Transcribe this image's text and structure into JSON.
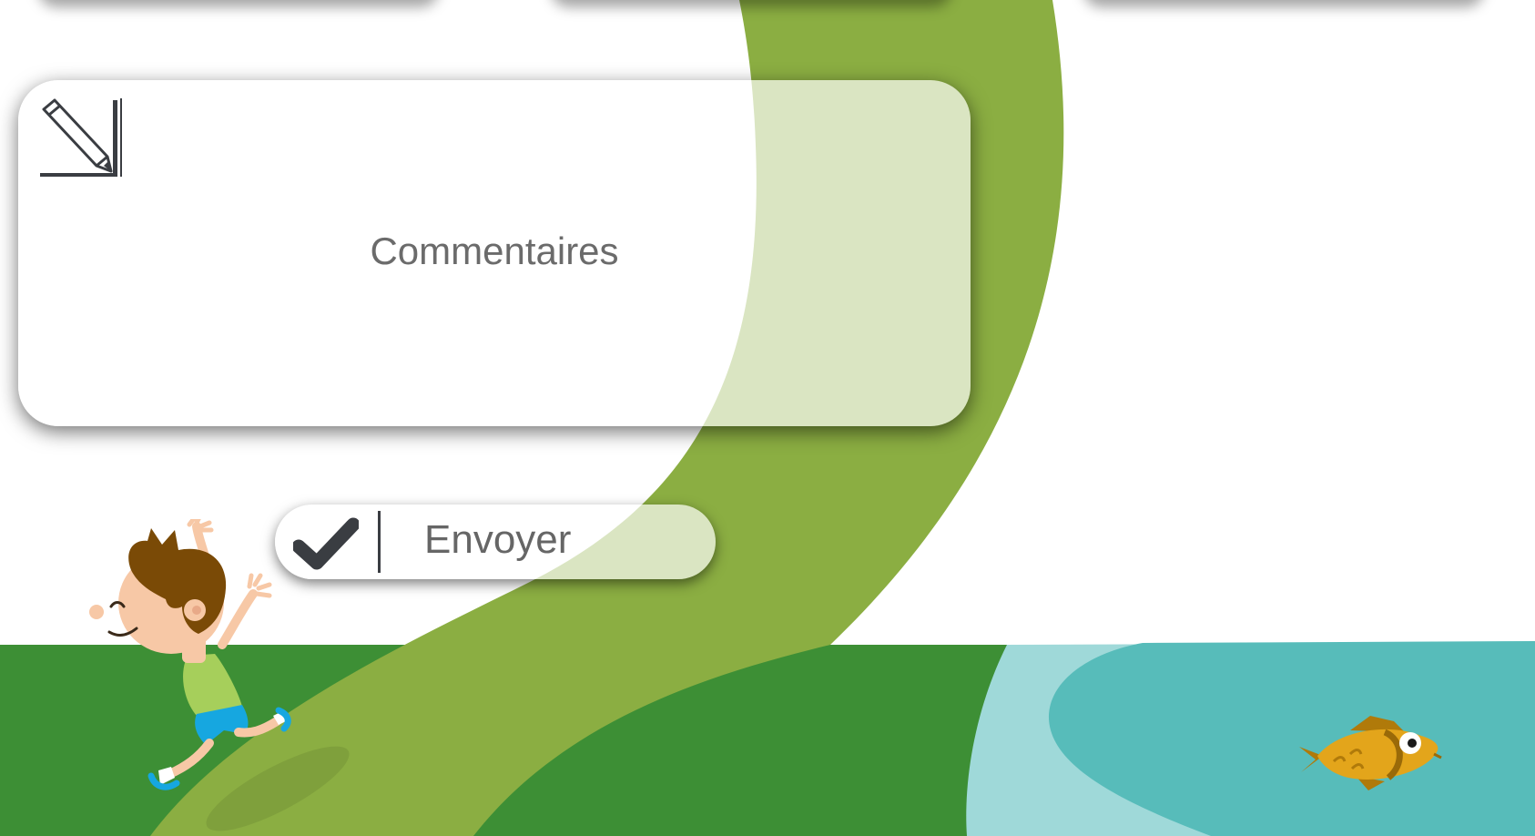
{
  "comment_field": {
    "placeholder": "Commentaires",
    "icon": "pencil-ruler-icon"
  },
  "send_button": {
    "label": "Envoyer",
    "icon": "checkmark-icon"
  },
  "colors": {
    "path_green": "#8bae42",
    "grass_green": "#3d8f35",
    "water_light": "#9fd9d9",
    "water_teal": "#57bcba",
    "icon_dark": "#3a3d42",
    "text_gray": "#6b6b6b"
  }
}
